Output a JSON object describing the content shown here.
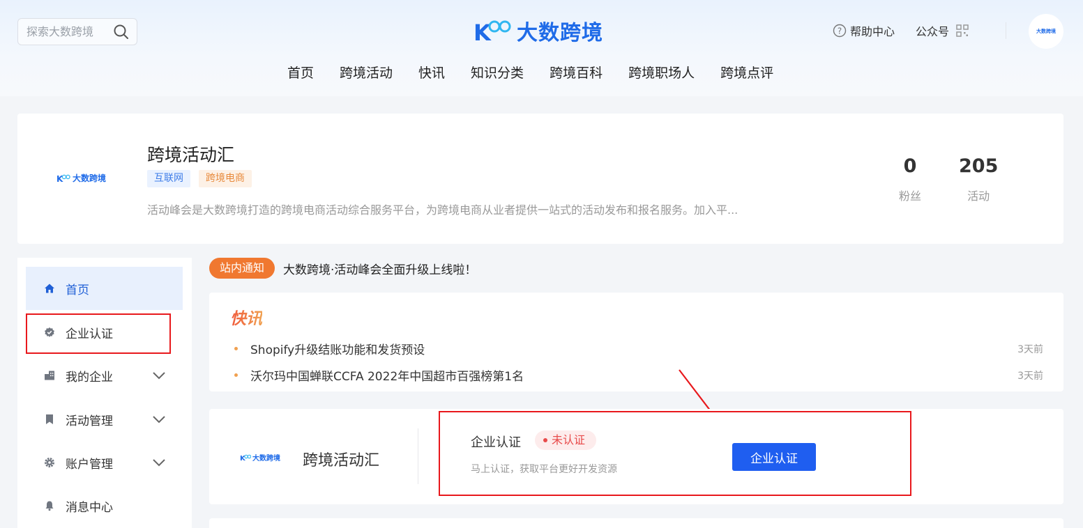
{
  "header": {
    "search_placeholder": "探索大数跨境",
    "logo_text": "大数跨境",
    "help_label": "帮助中心",
    "gzh_label": "公众号",
    "avatar_text": "大数跨境",
    "nav": [
      "首页",
      "跨境活动",
      "快讯",
      "知识分类",
      "跨境百科",
      "跨境职场人",
      "跨境点评"
    ]
  },
  "profile": {
    "logo_text": "大数跨境",
    "title": "跨境活动汇",
    "tags": [
      "互联网",
      "跨境电商"
    ],
    "description": "活动峰会是大数跨境打造的跨境电商活动综合服务平台，为跨境电商从业者提供一站式的活动发布和报名服务。加入平...",
    "stats": [
      {
        "num": "0",
        "label": "粉丝"
      },
      {
        "num": "205",
        "label": "活动"
      }
    ]
  },
  "sidebar": {
    "items": [
      {
        "label": "首页",
        "icon": "home-icon"
      },
      {
        "label": "企业认证",
        "icon": "badge-icon"
      },
      {
        "label": "我的企业",
        "icon": "building-icon"
      },
      {
        "label": "活动管理",
        "icon": "bookmark-icon"
      },
      {
        "label": "账户管理",
        "icon": "gear-icon"
      },
      {
        "label": "消息中心",
        "icon": "bell-icon"
      }
    ]
  },
  "notice": {
    "badge": "站内通知",
    "text": "大数跨境·活动峰会全面升级上线啦！"
  },
  "news": {
    "title": "快讯",
    "items": [
      {
        "text": "Shopify升级结账功能和发货预设",
        "time": "3天前"
      },
      {
        "text": "沃尔玛中国蝉联CCFA 2022年中国超市百强榜第1名",
        "time": "3天前"
      }
    ]
  },
  "cert": {
    "logo_text": "大数跨境",
    "name": "跨境活动汇",
    "label": "企业认证",
    "status": "未认证",
    "sub": "马上认证，获取平台更好开发资源",
    "button": "企业认证"
  },
  "colors": {
    "brand": "#1f6be8",
    "highlight": "#e8181c",
    "notice": "#f07830"
  }
}
